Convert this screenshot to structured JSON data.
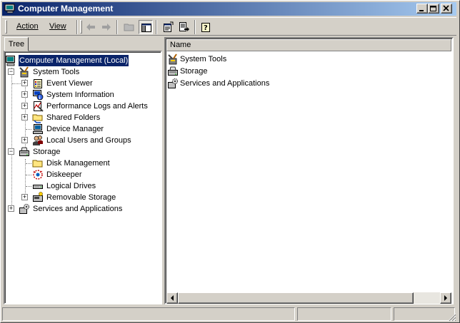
{
  "window": {
    "title": "Computer Management",
    "controls": {
      "minimize": "minimize",
      "restore": "restore",
      "close": "close"
    }
  },
  "menu": {
    "action_label": "Action",
    "view_label": "View"
  },
  "toolbar": {
    "buttons": [
      "back-arrow-icon",
      "forward-arrow-icon",
      "up-folder-icon",
      "show-hide-tree-icon",
      "properties-icon",
      "export-list-icon",
      "help-icon"
    ]
  },
  "tree": {
    "tab_label": "Tree",
    "root": {
      "label": "Computer Management (Local)",
      "selected": true
    },
    "system_tools": {
      "label": "System Tools",
      "children": [
        "Event Viewer",
        "System Information",
        "Performance Logs and Alerts",
        "Shared Folders",
        "Device Manager",
        "Local Users and Groups"
      ]
    },
    "storage": {
      "label": "Storage",
      "children": [
        "Disk Management",
        "Diskeeper",
        "Logical Drives",
        "Removable Storage"
      ]
    },
    "services": {
      "label": "Services and Applications"
    }
  },
  "list": {
    "column_name": "Name",
    "items": [
      "System Tools",
      "Storage",
      "Services and Applications"
    ]
  },
  "colors": {
    "title_start": "#0a246a",
    "title_end": "#a6caf0",
    "face": "#d4d0c8",
    "selection": "#0a246a"
  }
}
